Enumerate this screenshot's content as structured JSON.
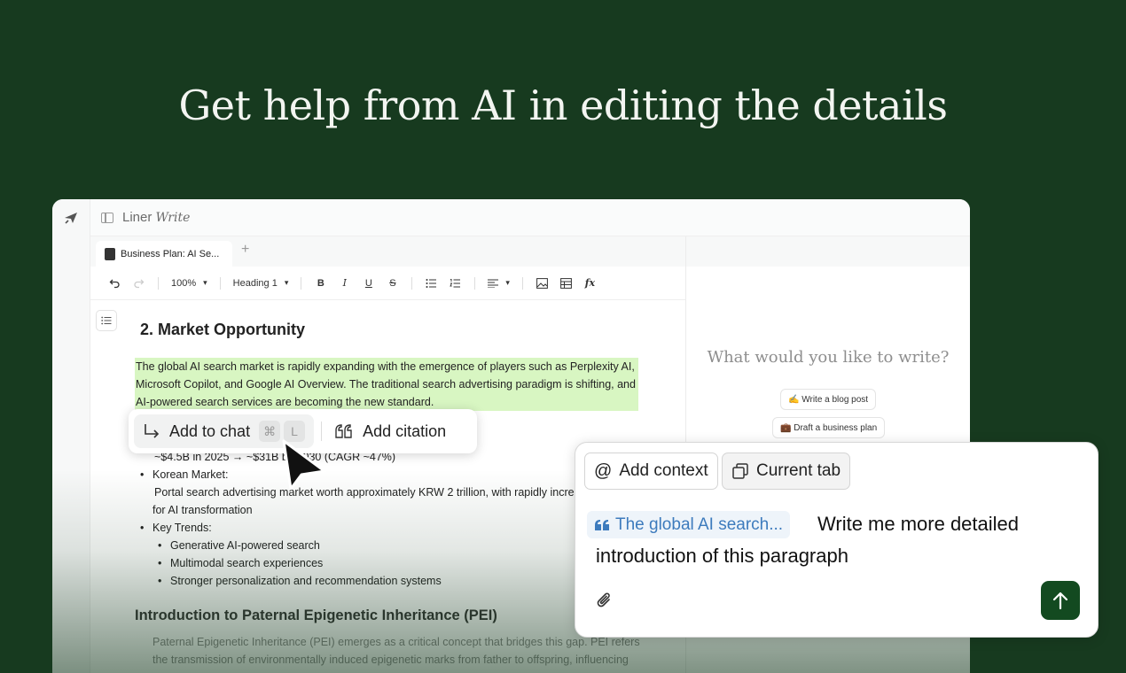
{
  "hero": {
    "title": "Get help from AI in editing the details"
  },
  "app": {
    "brand_main": "Liner",
    "brand_sub": "Write",
    "tab_title": "Business Plan: AI Se...",
    "tab_add": "+"
  },
  "toolbar": {
    "zoom": "100%",
    "style": "Heading 1",
    "bold": "B",
    "italic": "I",
    "underline": "U",
    "strike": "S",
    "formula": "fx"
  },
  "document": {
    "heading": "2. Market Opportunity",
    "highlight": "The global AI search market is rapidly expanding with the emergence of players such as Perplexity AI, Microsoft Copilot, and Google AI Overview. The traditional search advertising paradigm is shifting, and AI-powered search services are becoming the new standard.",
    "metric_line": "~$4.5B in 2025 → ~$31B by 2030 (CAGR ~47%)",
    "korean_market": "Korean Market:",
    "korean_detail": "Portal search advertising market worth approximately KRW 2 trillion, with rapidly increasing demand for AI transformation",
    "key_trends": "Key Trends:",
    "trends": [
      "Generative AI-powered search",
      "Multimodal search experiences",
      "Stronger personalization and recommendation systems"
    ],
    "subheading": "Introduction to Paternal Epigenetic Inheritance (PEI)",
    "pei_line1": "Paternal Epigenetic Inheritance (PEI) emerges as a critical concept that bridges this gap. PEI refers",
    "pei_line2": "the transmission of environmentally induced epigenetic marks from father to offspring, influencing"
  },
  "right_panel": {
    "prompt": "What would you like to write?",
    "suggestions": [
      "✍️ Write a blog post",
      "💼 Draft a business plan"
    ]
  },
  "popup": {
    "add_to_chat": "Add to chat",
    "shortcut_cmd": "⌘",
    "shortcut_key": "L",
    "add_citation": "Add citation"
  },
  "chatbox": {
    "add_context": "Add context",
    "current_tab": "Current tab",
    "quote_ref": "The global AI search...",
    "message_line1": "Write me more detailed",
    "message_line2": "introduction of this paragraph"
  },
  "colors": {
    "background": "#173a1f",
    "highlight": "#d8f6c2",
    "send_button": "#134a20",
    "quote_chip_text": "#3d7bbd"
  }
}
